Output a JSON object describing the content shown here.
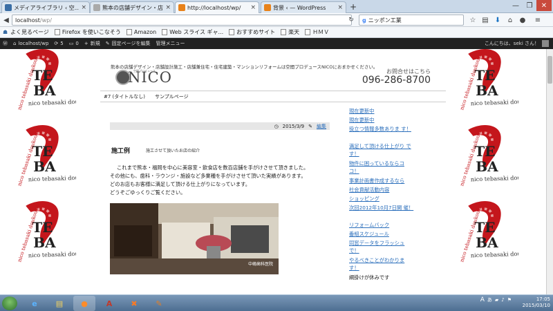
{
  "browser": {
    "tabs": [
      {
        "title": "メディアライブラリ ‹ 空...",
        "color": "#3a6ea5"
      },
      {
        "title": "熊本の店舗デザイン・店...",
        "color": "#aaaaaa"
      },
      {
        "title": "http://localhost/wp/",
        "color": "#e8821a"
      },
      {
        "title": "背景 ‹ — WordPress",
        "color": "#e8821a"
      }
    ],
    "url_host": "localhost",
    "url_path": "/wp/",
    "search_text": "ニッポン工業",
    "bookmarks": [
      "よく見るページ",
      "Firefox を使いこなそう",
      "Amazon",
      "Web スライス ギャ...",
      "おすすめサイト",
      "楽天",
      "ＨＭＶ"
    ]
  },
  "adminbar": {
    "site": "localhost/wp",
    "updates": "5",
    "comments": "0",
    "new": "新規",
    "edit": "固定ページを編集",
    "manage": "管理メニュー",
    "greeting": "こんにちは、seki さん！"
  },
  "background": {
    "line1": "TE",
    "line2": "BA",
    "script": "nico tebasaki doukoukai",
    "color": "#c4161c"
  },
  "site": {
    "tagline": "熊本の店舗デザイン・店舗設計施工・店舗兼住宅・住宅建築・マンションリフォームは空間プロデュースNICOにおまかせください。",
    "logo": "NICO",
    "logo_sub": "空間プロデュース",
    "contact_label": "お問合せはこちら",
    "contact_phone": "096-286-8700",
    "menu": [
      "#7 (タイトルなし)",
      "サンプルページ"
    ]
  },
  "post": {
    "date": "2015/3/9",
    "edit": "編集",
    "title": "施工例",
    "subtitle": "施工させて頂いたお店の紹介",
    "paragraphs": [
      "これまで熊本・福岡を中心に美容室・飲食店を数百店舗を手がけさせて頂きました。",
      "その他にも、歯科・ラウンジ・施設など多業種を手がけさせて頂いた実績があります。",
      "どのお店もお客様に満足して頂ける仕上がりになっています。",
      "どうぞごゆっくりご覧ください。"
    ],
    "photo_caption": "中嶋歯科医院"
  },
  "sidebar": {
    "links": [
      "現在更新中",
      "現在更新中",
      "役立つ情報多数ありま す！",
      "満足して頂ける仕上がり です！",
      "物件に困っているならコ コ！",
      "事業計画書作成するなら",
      "社会貢献活動内容",
      "ショッピング",
      "次回2012年10月7日開 催！",
      "リフォームバック",
      "番組スケジュール",
      "同窓データをフラッシュ で！",
      "やるべきことがわかりま す！"
    ],
    "footer_text": "綱掛けが休みです"
  },
  "taskbar": {
    "time": "17:05",
    "date": "2015/03/10",
    "lang": "A"
  }
}
